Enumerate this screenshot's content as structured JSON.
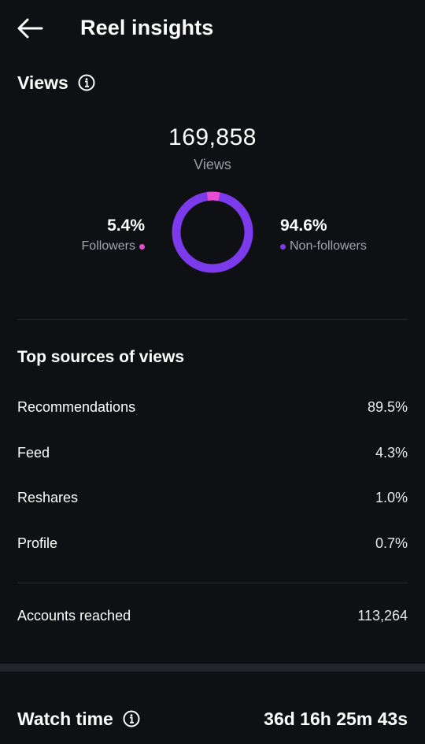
{
  "header": {
    "title": "Reel insights",
    "back_icon": "arrow-left-icon"
  },
  "views": {
    "heading": "Views",
    "total": "169,858",
    "total_label": "Views",
    "followers_pct": "5.4%",
    "followers_label": "Followers",
    "non_followers_pct": "94.6%",
    "non_followers_label": "Non-followers",
    "followers_fraction": 0.054,
    "colors": {
      "followers": "#e94bd3",
      "non_followers": "#7c3aed"
    }
  },
  "top_sources": {
    "heading": "Top sources of views",
    "items": [
      {
        "label": "Recommendations",
        "value": "89.5%"
      },
      {
        "label": "Feed",
        "value": "4.3%"
      },
      {
        "label": "Reshares",
        "value": "1.0%"
      },
      {
        "label": "Profile",
        "value": "0.7%"
      }
    ]
  },
  "accounts_reached": {
    "label": "Accounts reached",
    "value": "113,264"
  },
  "watch_time": {
    "label": "Watch time",
    "value": "36d 16h 25m 43s"
  }
}
